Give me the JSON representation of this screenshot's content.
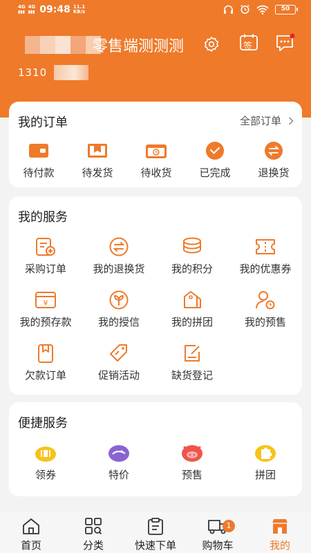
{
  "theme": {
    "accent": "#ee7a2a",
    "background": "#f3f3f3",
    "card": "#ffffff"
  },
  "status_bar": {
    "network_1": "4G",
    "network_2": "4G",
    "time": "09:48",
    "speed_value": "11.1",
    "speed_unit": "KB/s",
    "battery": "50"
  },
  "header": {
    "shop_name": "零售端测测测",
    "phone_prefix": "1310",
    "icons": [
      "settings-icon",
      "sign-in-icon",
      "message-icon"
    ],
    "sign_label": "签"
  },
  "orders": {
    "title": "我的订单",
    "all_link": "全部订单",
    "items": [
      {
        "label": "待付款",
        "icon": "wallet-icon"
      },
      {
        "label": "待发货",
        "icon": "package-icon"
      },
      {
        "label": "待收货",
        "icon": "delivery-box-icon"
      },
      {
        "label": "已完成",
        "icon": "check-circle-icon"
      },
      {
        "label": "退换货",
        "icon": "exchange-icon"
      }
    ]
  },
  "services": {
    "title": "我的服务",
    "items": [
      {
        "label": "采购订单",
        "icon": "purchase-order-icon"
      },
      {
        "label": "我的退换货",
        "icon": "return-exchange-icon"
      },
      {
        "label": "我的积分",
        "icon": "points-icon"
      },
      {
        "label": "我的优惠券",
        "icon": "coupon-icon"
      },
      {
        "label": "我的预存款",
        "icon": "deposit-icon"
      },
      {
        "label": "我的授信",
        "icon": "credit-icon"
      },
      {
        "label": "我的拼团",
        "icon": "group-buy-icon"
      },
      {
        "label": "我的预售",
        "icon": "presale-icon"
      },
      {
        "label": "欠款订单",
        "icon": "debt-order-icon"
      },
      {
        "label": "促销活动",
        "icon": "promotion-icon"
      },
      {
        "label": "缺货登记",
        "icon": "out-of-stock-icon"
      }
    ]
  },
  "quick": {
    "title": "便捷服务",
    "items": [
      {
        "label": "领券",
        "icon": "get-coupon-icon",
        "color": "#f7c21b"
      },
      {
        "label": "特价",
        "icon": "special-price-icon",
        "color": "#8a63d2"
      },
      {
        "label": "预售",
        "icon": "presale-pig-icon",
        "color": "#f0554b"
      },
      {
        "label": "拼团",
        "icon": "puzzle-icon",
        "color": "#f7c21b"
      }
    ]
  },
  "bottom_nav": {
    "items": [
      {
        "label": "首页",
        "icon": "home-icon"
      },
      {
        "label": "分类",
        "icon": "category-icon"
      },
      {
        "label": "快速下单",
        "icon": "quick-order-icon"
      },
      {
        "label": "购物车",
        "icon": "cart-icon",
        "badge": "1"
      },
      {
        "label": "我的",
        "icon": "profile-shop-icon",
        "active": true
      }
    ]
  }
}
